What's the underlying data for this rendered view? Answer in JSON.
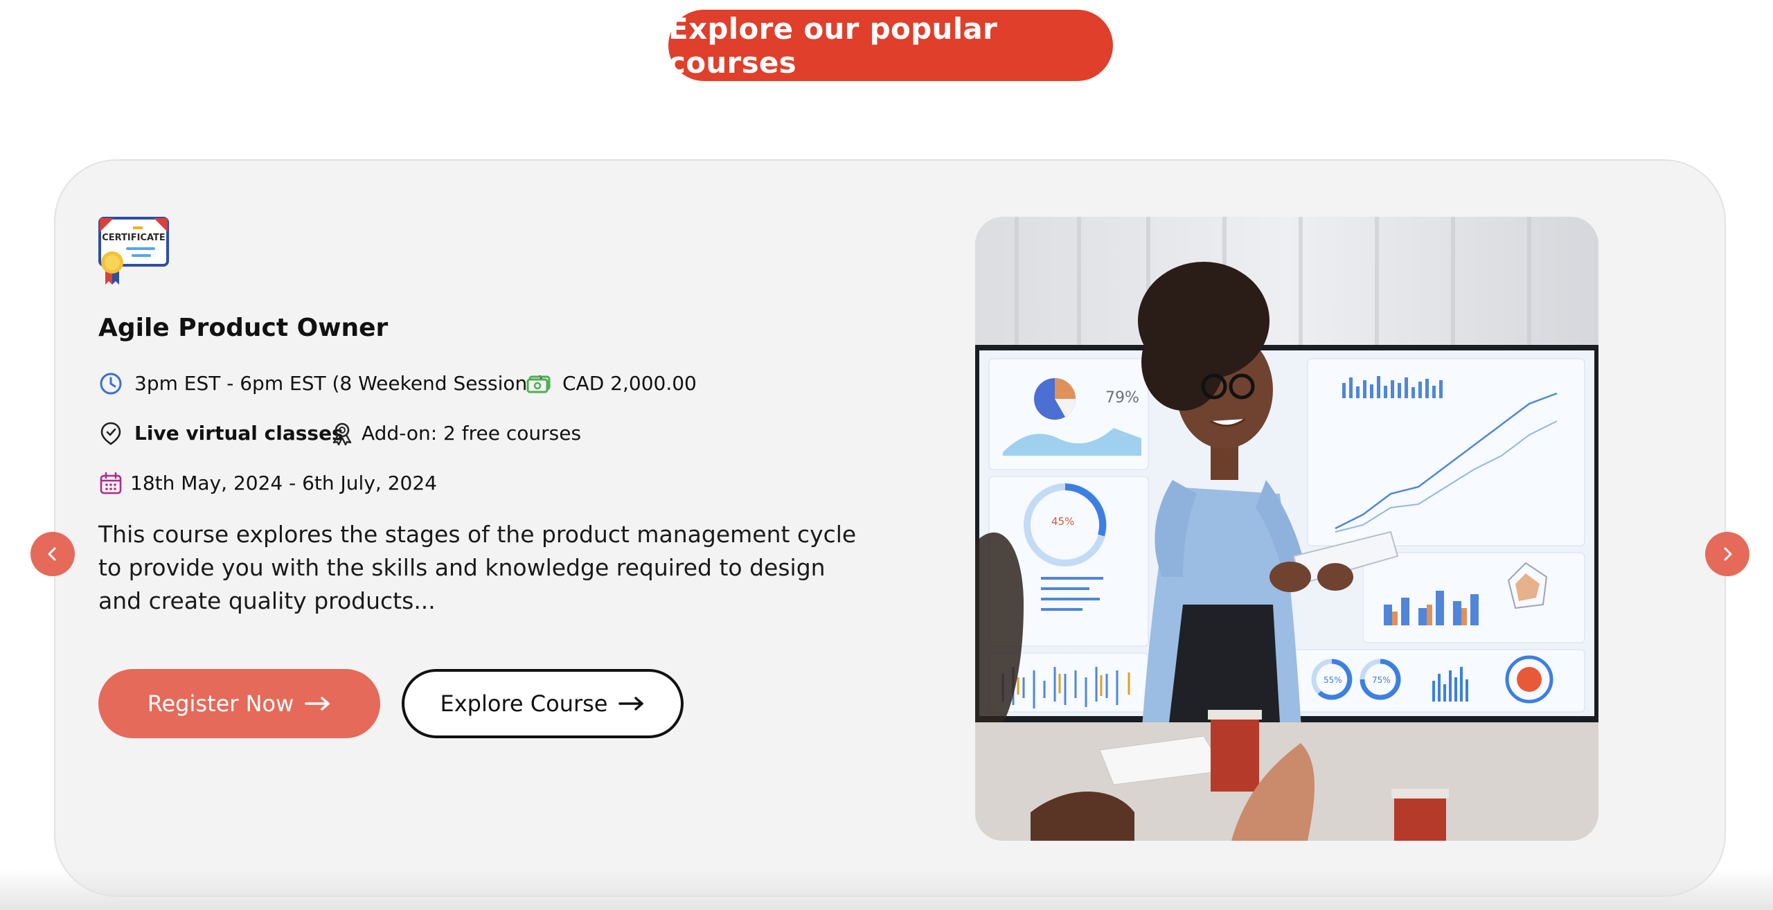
{
  "hero": {
    "label": "Explore our popular courses"
  },
  "course": {
    "badge_text": "CERTIFICATE",
    "title": "Agile Product Owner",
    "schedule": "3pm EST - 6pm EST (8 Weekend Sessions)",
    "price": "CAD 2,000.00",
    "format": "Live virtual classes",
    "addon": "Add-on: 2 free courses",
    "dates": "18th May, 2024 - 6th July, 2024",
    "description": "This course explores the stages of the product management cycle to provide you with the skills and knowledge required to design and create quality products...",
    "register_label": "Register Now",
    "explore_label": "Explore Course"
  },
  "colors": {
    "accent": "#df3f2b",
    "button": "#e56a59",
    "card_bg": "#f3f3f3",
    "icon_clock": "#3b6fd8",
    "icon_money": "#4caf50",
    "icon_calendar": "#b02a8a"
  },
  "icons": {
    "clock": "clock-icon",
    "money": "money-icon",
    "location": "location-icon",
    "award": "award-icon",
    "calendar": "calendar-icon",
    "arrow": "arrow-right-icon",
    "prev": "chevron-left-icon",
    "next": "chevron-right-icon"
  },
  "photo": {
    "chart_text": [
      "79%",
      "45%",
      "55%",
      "75%"
    ]
  }
}
